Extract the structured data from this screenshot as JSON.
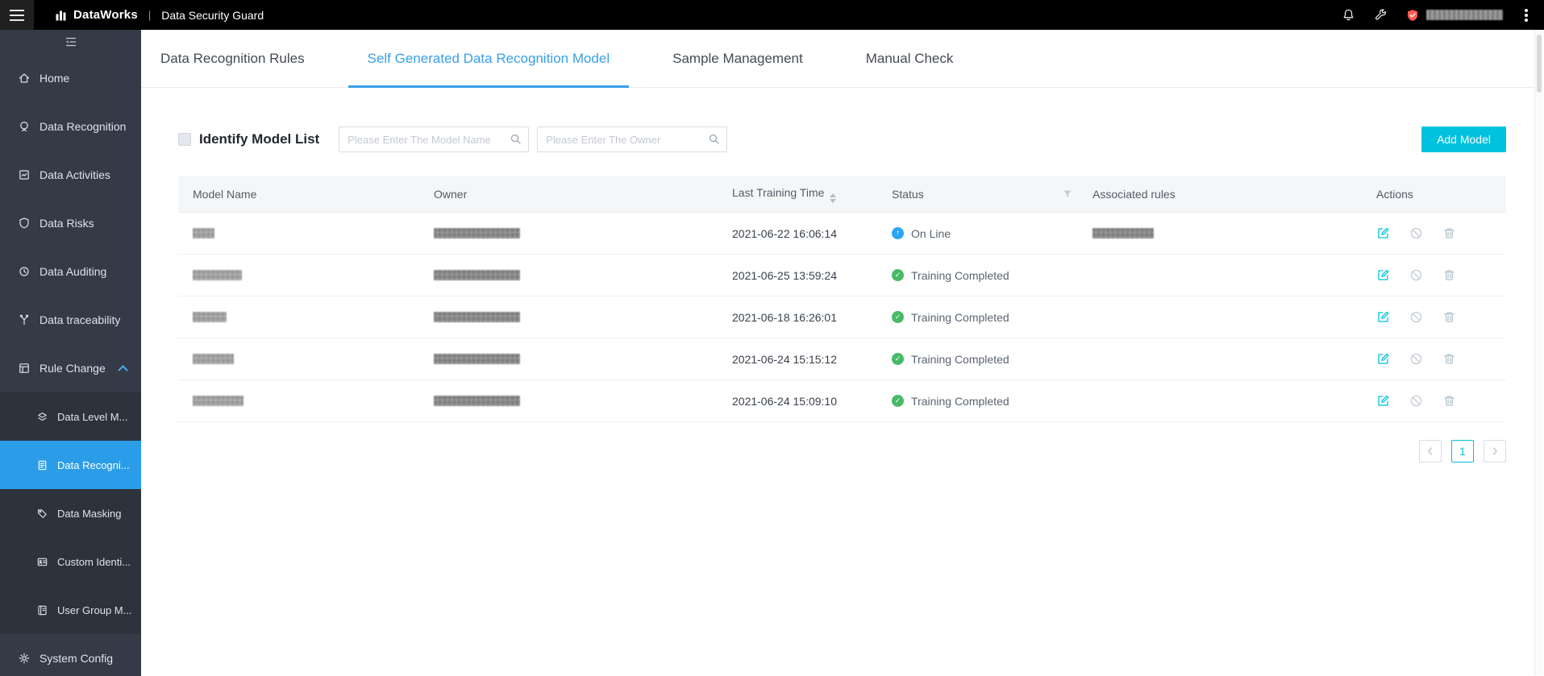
{
  "colors": {
    "accent": "#38a0e8",
    "teal": "#00c1de",
    "online": "#29a5f2",
    "success": "#47ba67",
    "danger": "#ff5a52",
    "sidebar-bg": "#343b46",
    "sidebar-sub-bg": "#2d333d",
    "sidebar-active": "#2b9de8",
    "topbar-bg": "#000000"
  },
  "topbar": {
    "product": "DataWorks",
    "divider": "|",
    "title": "Data Security Guard",
    "account_blur_w": 95
  },
  "sidebar": {
    "items": [
      {
        "label": "Home",
        "icon": "home-icon"
      },
      {
        "label": "Data Recognition",
        "icon": "data-recognition-icon"
      },
      {
        "label": "Data Activities",
        "icon": "data-activities-icon"
      },
      {
        "label": "Data Risks",
        "icon": "data-risks-icon"
      },
      {
        "label": "Data Auditing",
        "icon": "data-auditing-icon"
      },
      {
        "label": "Data traceability",
        "icon": "data-traceability-icon"
      },
      {
        "label": "Rule Change",
        "icon": "rule-change-icon",
        "expanded": true
      }
    ],
    "subitems": [
      {
        "label": "Data Level M...",
        "icon": "data-level-icon"
      },
      {
        "label": "Data Recogni...",
        "icon": "data-recognition-sub-icon",
        "active": true
      },
      {
        "label": "Data Masking",
        "icon": "data-masking-icon"
      },
      {
        "label": "Custom Identi...",
        "icon": "custom-identification-icon"
      },
      {
        "label": "User Group M...",
        "icon": "user-group-icon"
      }
    ],
    "bottom": {
      "label": "System Config",
      "icon": "system-config-icon"
    }
  },
  "tabs": [
    {
      "label": "Data Recognition Rules",
      "active": false
    },
    {
      "label": "Self Generated Data Recognition Model",
      "active": true
    },
    {
      "label": "Sample Management",
      "active": false
    },
    {
      "label": "Manual Check",
      "active": false
    }
  ],
  "toolbar": {
    "title": "Identify Model List",
    "model_placeholder": "Please Enter The Model Name",
    "owner_placeholder": "Please Enter The Owner",
    "add_button": "Add Model"
  },
  "table": {
    "headers": {
      "model": "Model Name",
      "owner": "Owner",
      "time": "Last Training Time",
      "status": "Status",
      "rules": "Associated rules",
      "actions": "Actions"
    },
    "rows": [
      {
        "model_w": 27,
        "owner_w": 107,
        "time": "2021-06-22 16:06:14",
        "status": "On Line",
        "status_type": "online",
        "rules_w": 76
      },
      {
        "model_w": 61,
        "owner_w": 107,
        "time": "2021-06-25 13:59:24",
        "status": "Training Completed",
        "status_type": "success",
        "rules_w": 0
      },
      {
        "model_w": 42,
        "owner_w": 107,
        "time": "2021-06-18 16:26:01",
        "status": "Training Completed",
        "status_type": "success",
        "rules_w": 0
      },
      {
        "model_w": 51,
        "owner_w": 107,
        "time": "2021-06-24 15:15:12",
        "status": "Training Completed",
        "status_type": "success",
        "rules_w": 0
      },
      {
        "model_w": 63,
        "owner_w": 107,
        "time": "2021-06-24 15:09:10",
        "status": "Training Completed",
        "status_type": "success",
        "rules_w": 0
      }
    ]
  },
  "pagination": {
    "page": "1"
  }
}
